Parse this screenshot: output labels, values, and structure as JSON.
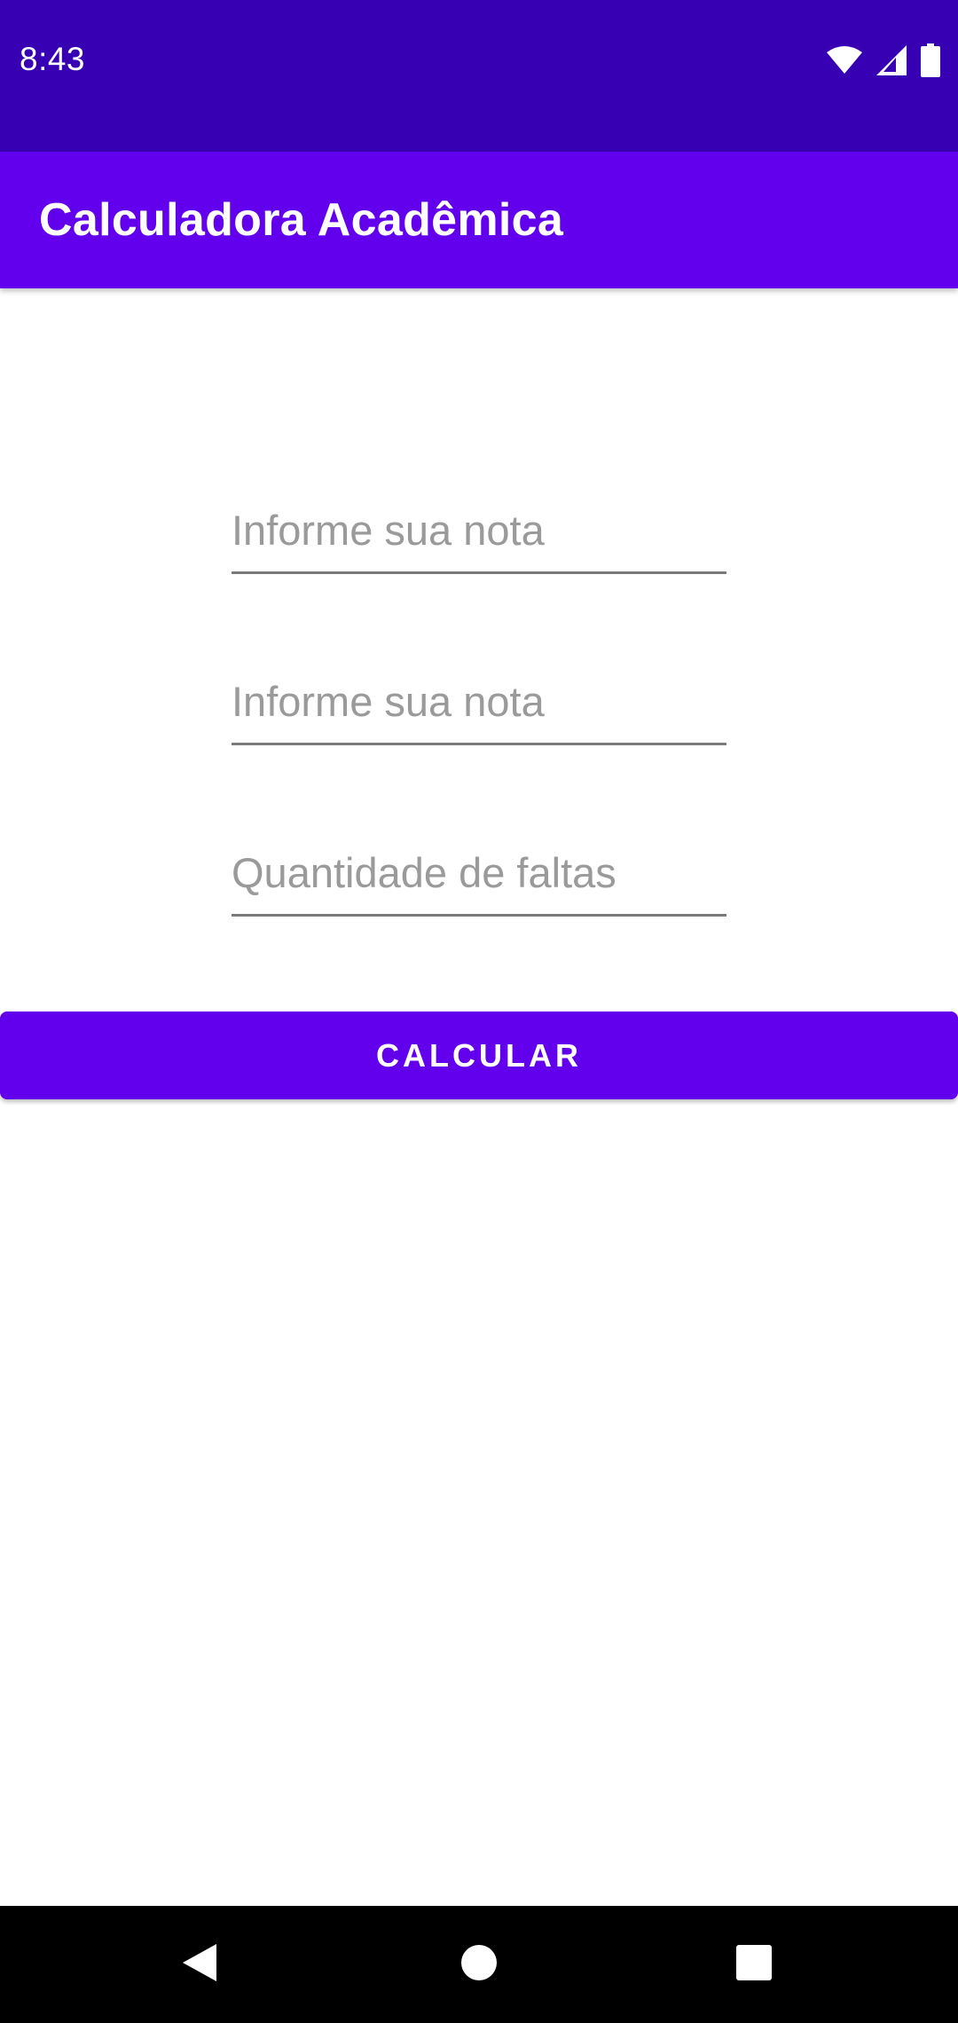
{
  "status_bar": {
    "time": "8:43",
    "icons": [
      "wifi-icon",
      "cellular-signal-icon",
      "battery-icon"
    ]
  },
  "app_bar": {
    "title": "Calculadora Acadêmica"
  },
  "form": {
    "grade1": {
      "placeholder": "Informe sua nota",
      "value": ""
    },
    "grade2": {
      "placeholder": "Informe sua nota",
      "value": ""
    },
    "absences": {
      "placeholder": "Quantidade de faltas",
      "value": ""
    },
    "calculate_label": "CALCULAR"
  },
  "nav_bar": {
    "icons": [
      "back-icon",
      "home-icon",
      "recents-icon"
    ]
  },
  "colors": {
    "status_bar": "#3700b3",
    "primary": "#6200ee",
    "nav_bar": "#000000",
    "hint_text": "#9a9a9a"
  }
}
